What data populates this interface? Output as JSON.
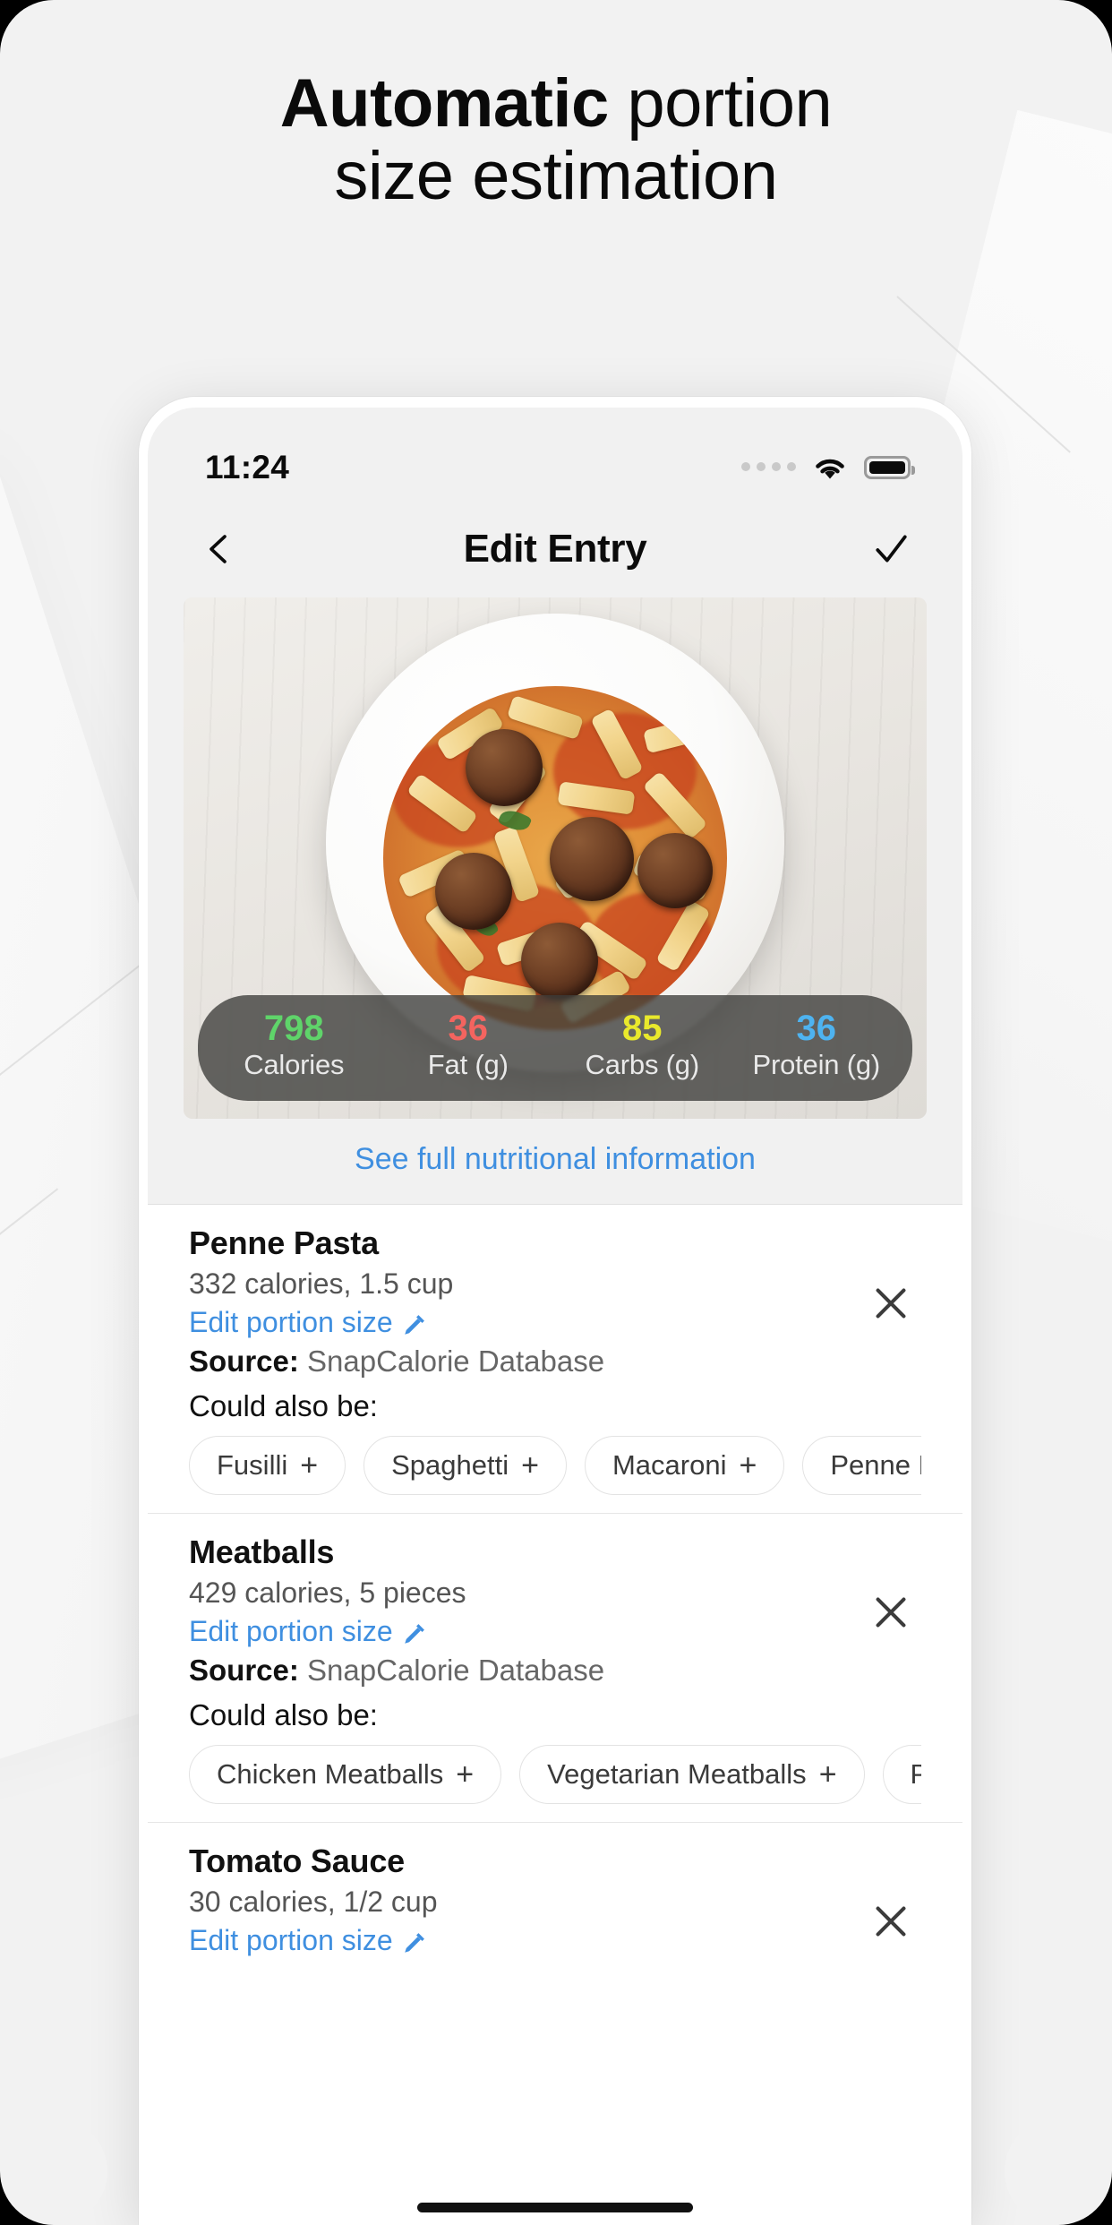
{
  "headline": {
    "strong": "Automatic",
    "rest": " portion",
    "line2": "size estimation"
  },
  "phone": {
    "status_bar": {
      "time": "11:24",
      "signal_icon": "signal-dots-icon",
      "wifi_icon": "wifi-icon",
      "battery_icon": "battery-full-icon"
    },
    "nav": {
      "back_icon": "chevron-left-icon",
      "title": "Edit Entry",
      "confirm_icon": "checkmark-icon"
    },
    "hero": {
      "photo_alt": "penne-pasta-with-meatballs-photo",
      "macros": [
        {
          "value": "798",
          "label": "Calories",
          "color": "#5fd46a"
        },
        {
          "value": "36",
          "label": "Fat (g)",
          "color": "#f4645f"
        },
        {
          "value": "85",
          "label": "Carbs (g)",
          "color": "#e9e92c"
        },
        {
          "value": "36",
          "label": "Protein (g)",
          "color": "#4eb3f0"
        }
      ],
      "nutrition_link": "See full nutritional information"
    },
    "items": [
      {
        "name": "Penne Pasta",
        "calories": "332 calories, 1.5 cup",
        "edit_label": "Edit portion size",
        "source_label": "Source:",
        "source_value": "SnapCalorie Database",
        "alt_label": "Could also be:",
        "alternatives": [
          "Fusilli",
          "Spaghetti",
          "Macaroni",
          "Penne P"
        ],
        "remove_icon": "close-icon"
      },
      {
        "name": "Meatballs",
        "calories": "429 calories, 5 pieces",
        "edit_label": "Edit portion size",
        "source_label": "Source:",
        "source_value": "SnapCalorie Database",
        "alt_label": "Could also be:",
        "alternatives": [
          "Chicken Meatballs",
          "Vegetarian Meatballs",
          "P"
        ],
        "remove_icon": "close-icon"
      },
      {
        "name": "Tomato Sauce",
        "calories": "30 calories, 1/2 cup",
        "edit_label": "Edit portion size",
        "source_label": "",
        "source_value": "",
        "alt_label": "",
        "alternatives": [],
        "remove_icon": "close-icon"
      }
    ]
  },
  "colors": {
    "accent_blue": "#3f8fe0",
    "page_bg": "#f2f2f2",
    "panel_bg": "#f1f1f1"
  }
}
